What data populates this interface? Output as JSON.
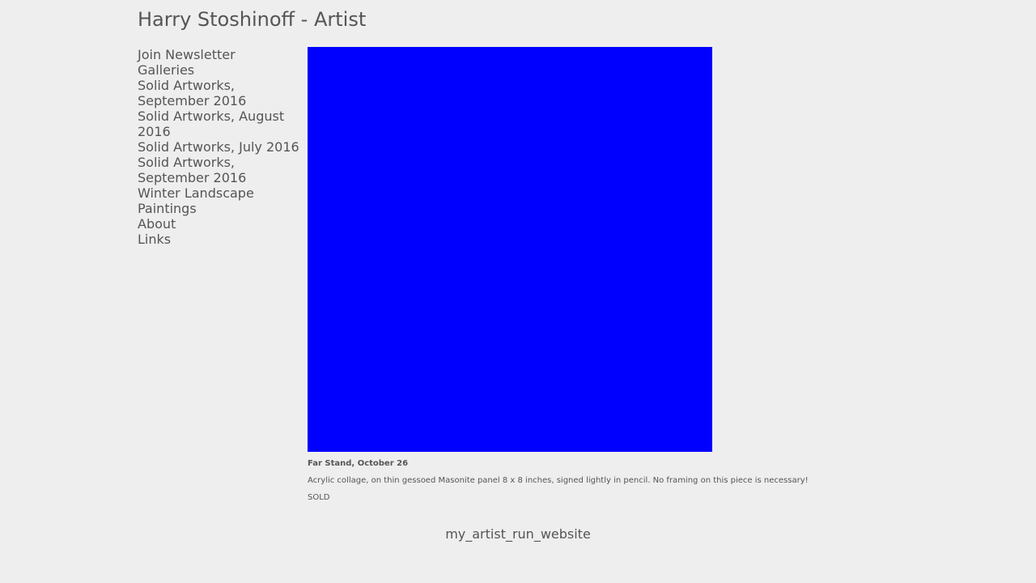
{
  "site": {
    "title": "Harry Stoshinoff - Artist"
  },
  "nav": {
    "items": [
      {
        "label": "Join Newsletter"
      },
      {
        "label": "Galleries"
      },
      {
        "label": "Solid Artworks, September 2016"
      },
      {
        "label": "Solid Artworks, August 2016"
      },
      {
        "label": "Solid Artworks, July 2016"
      },
      {
        "label": "Solid Artworks, September 2016"
      },
      {
        "label": "Winter Landscape Paintings"
      },
      {
        "label": "About"
      },
      {
        "label": "Links"
      }
    ]
  },
  "artwork": {
    "color": "#0000ff",
    "title": "Far Stand, October 26",
    "description": "Acrylic collage, on thin gessoed Masonite panel 8 x 8 inches, signed lightly in pencil. No framing on this piece is necessary!",
    "status": "SOLD"
  },
  "footer": {
    "link_label": "my_artist_run_website"
  }
}
